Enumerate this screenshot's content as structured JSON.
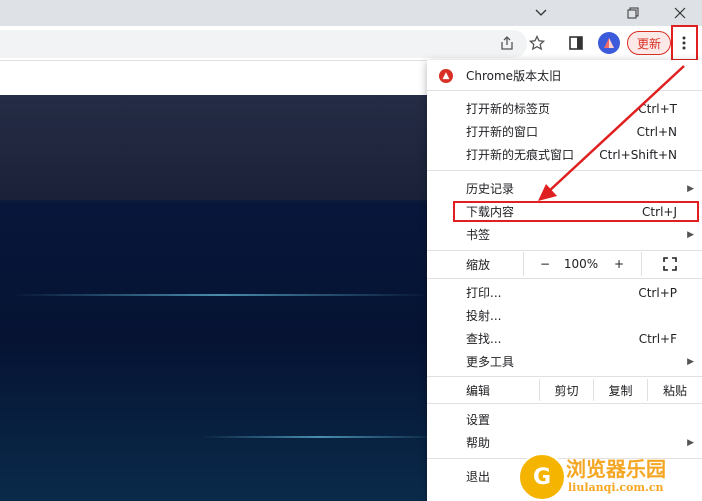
{
  "window": {
    "controls": [
      "chevron-down-icon",
      "restore-icon",
      "close-icon"
    ]
  },
  "toolbar": {
    "update_label": "更新",
    "icons": [
      "share-icon",
      "star-icon",
      "side-panel-icon",
      "profile-avatar",
      "more-vert-icon"
    ]
  },
  "menu": {
    "update_notice": "Chrome版本太旧",
    "items": [
      {
        "label": "打开新的标签页",
        "shortcut": "Ctrl+T"
      },
      {
        "label": "打开新的窗口",
        "shortcut": "Ctrl+N"
      },
      {
        "label": "打开新的无痕式窗口",
        "shortcut": "Ctrl+Shift+N"
      },
      {
        "label": "历史记录",
        "shortcut": ""
      },
      {
        "label": "下载内容",
        "shortcut": "Ctrl+J"
      },
      {
        "label": "书签",
        "shortcut": ""
      },
      {
        "label": "打印...",
        "shortcut": "Ctrl+P"
      },
      {
        "label": "投射...",
        "shortcut": ""
      },
      {
        "label": "查找...",
        "shortcut": "Ctrl+F"
      },
      {
        "label": "更多工具",
        "shortcut": ""
      },
      {
        "label": "设置",
        "shortcut": ""
      },
      {
        "label": "帮助",
        "shortcut": ""
      },
      {
        "label": "退出",
        "shortcut": ""
      }
    ],
    "zoom": {
      "label": "缩放",
      "minus": "−",
      "value": "100%",
      "plus": "+"
    },
    "edit": {
      "label": "编辑",
      "cut": "剪切",
      "copy": "复制",
      "paste": "粘贴"
    }
  },
  "watermark": {
    "title": "浏览器乐园",
    "url": "liulanqi.com.cn",
    "logo_letter": "G"
  },
  "colors": {
    "highlight": "#e02020",
    "update": "#d93025",
    "accent": "#f5a623"
  }
}
